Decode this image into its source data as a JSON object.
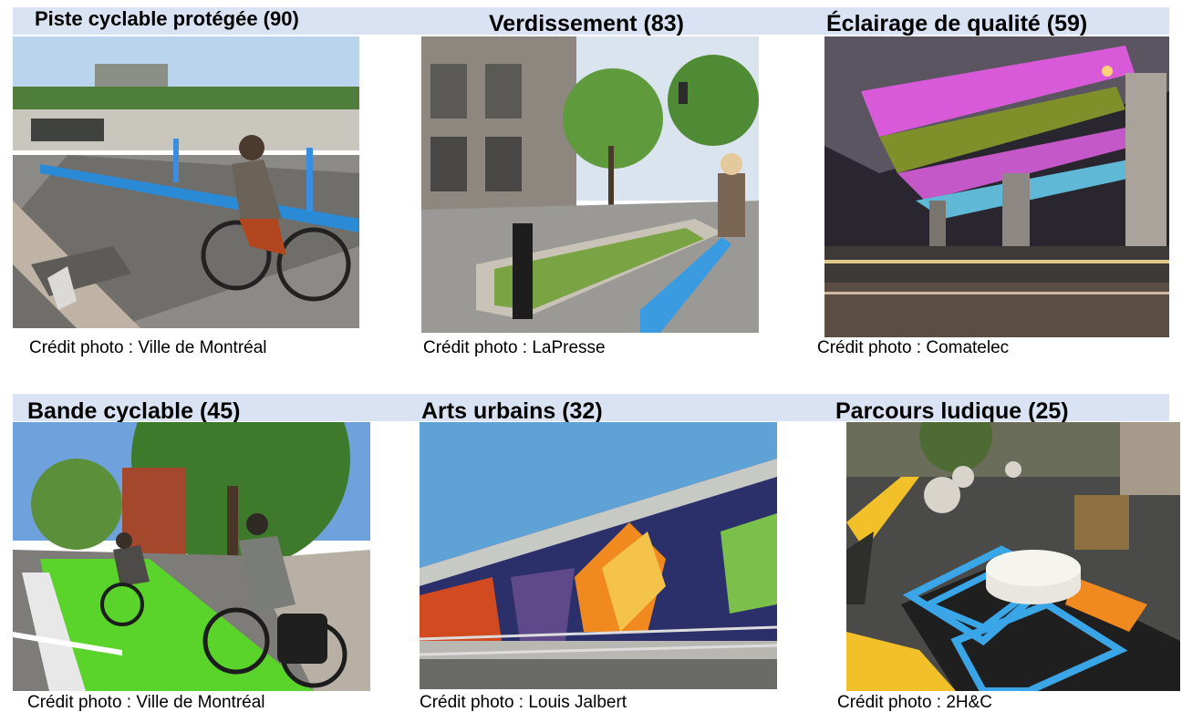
{
  "row1": [
    {
      "title": "Piste cyclable protégée (90)",
      "credit": "Crédit photo : Ville de Montréal",
      "photo": "protected-bike-lane-photo"
    },
    {
      "title": "Verdissement (83)",
      "credit": "Crédit photo : LaPresse",
      "photo": "greening-photo"
    },
    {
      "title": "Éclairage de qualité (59)",
      "credit": "Crédit photo : Comatelec",
      "photo": "quality-lighting-photo"
    }
  ],
  "row2": [
    {
      "title": "Bande cyclable (45)",
      "credit": "Crédit photo : Ville de Montréal",
      "photo": "bike-lane-photo"
    },
    {
      "title": "Arts urbains (32)",
      "credit": "Crédit photo : Louis Jalbert",
      "photo": "urban-art-photo"
    },
    {
      "title": "Parcours ludique (25)",
      "credit": "Crédit photo : 2H&C",
      "photo": "playful-path-photo"
    }
  ],
  "colors": {
    "band": "#dae3f3",
    "bike_green": "#5ad32a",
    "bollard_blue": "#3a8ee0"
  }
}
